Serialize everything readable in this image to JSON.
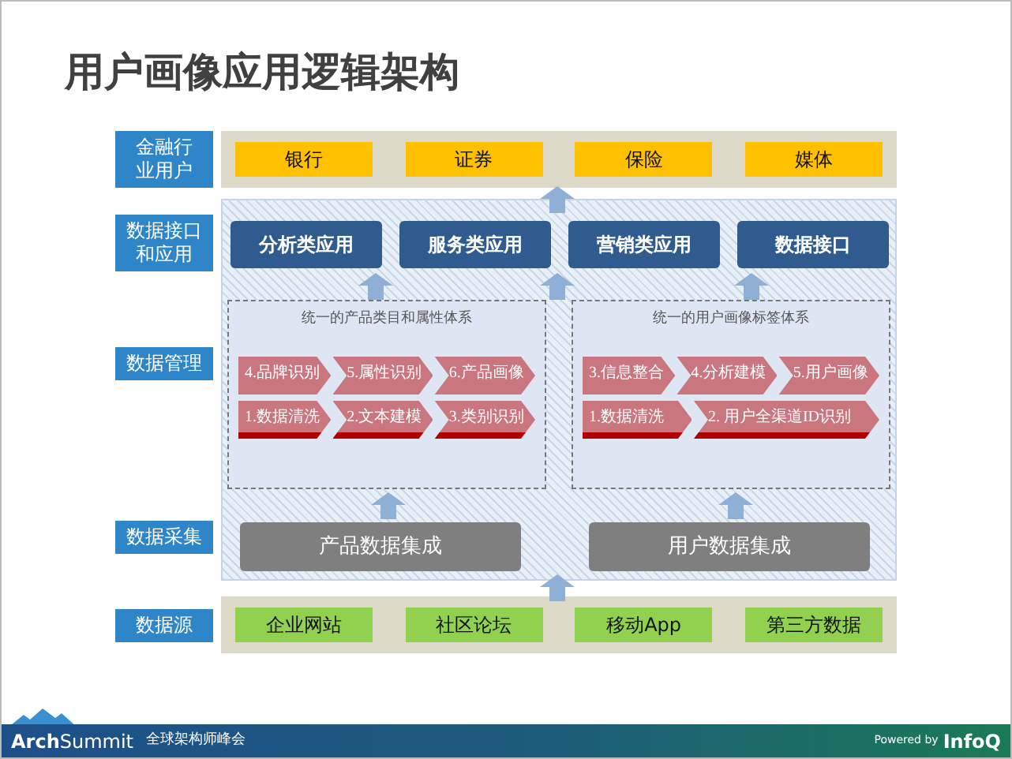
{
  "title": "用户画像应用逻辑架构",
  "industry": {
    "label": [
      "金融行",
      "业用户"
    ],
    "items": [
      "银行",
      "证券",
      "保险",
      "媒体"
    ]
  },
  "apps": {
    "label": [
      "数据接口",
      "和应用"
    ],
    "items": [
      "分析类应用",
      "服务类应用",
      "营销类应用",
      "数据接口"
    ]
  },
  "management": {
    "label": [
      "数据管理"
    ],
    "groups": [
      {
        "title": "统一的产品类目和属性体系",
        "rows": [
          [
            "4.品牌识别",
            "5.属性识别",
            "6.产品画像"
          ],
          [
            "1.数据清洗",
            "2.文本建模",
            "3.类别识别"
          ]
        ]
      },
      {
        "title": "统一的用户画像标签体系",
        "rows": [
          [
            "3.信息整合",
            "4.分析建模",
            "5.用户画像"
          ],
          [
            "1.数据清洗",
            "2. 用户全渠道ID识别"
          ]
        ]
      }
    ]
  },
  "collection": {
    "label": [
      "数据采集"
    ],
    "items": [
      "产品数据集成",
      "用户数据集成"
    ]
  },
  "sources": {
    "label": [
      "数据源"
    ],
    "items": [
      "企业网站",
      "社区论坛",
      "移动App",
      "第三方数据"
    ]
  },
  "footer": {
    "brand_bold": "Arch",
    "brand": "Summit",
    "subtitle": "全球架构师峰会",
    "powered": "Powered by",
    "partner": "InfoQ"
  }
}
